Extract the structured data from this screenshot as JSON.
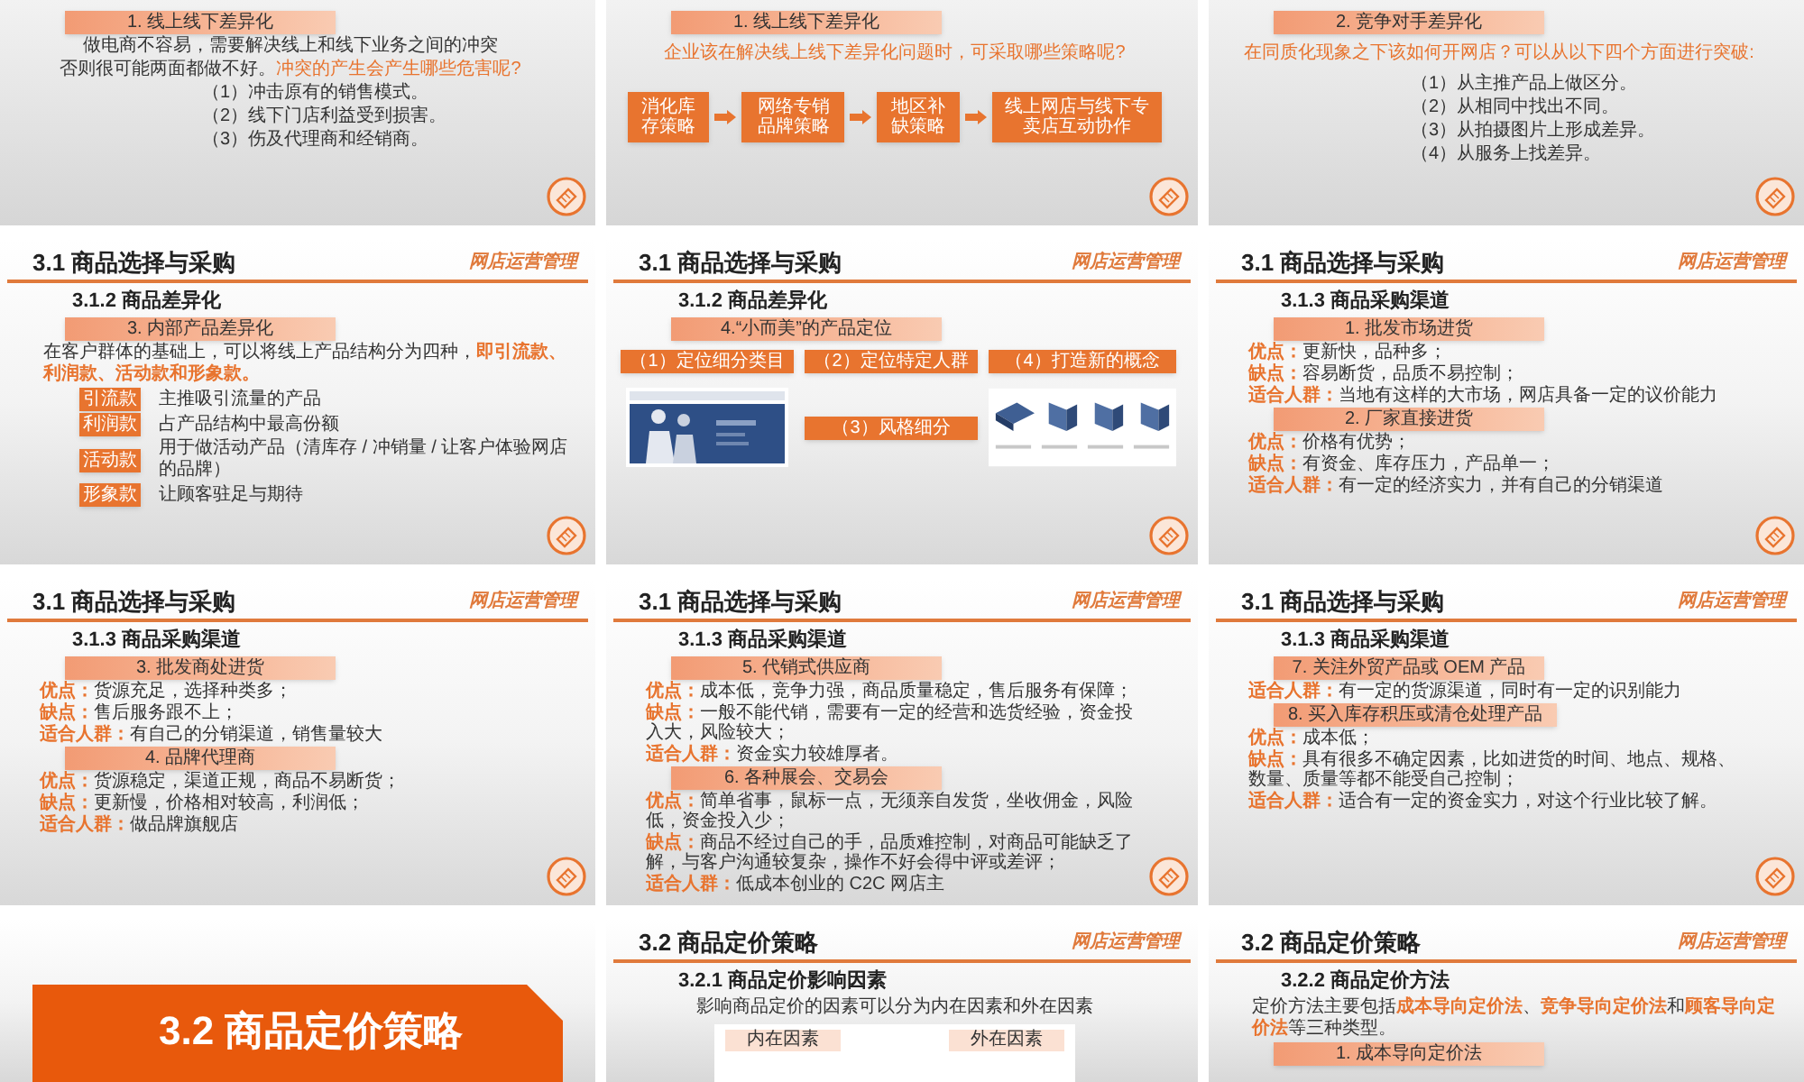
{
  "slides": [
    {
      "kind": "content",
      "blocks": [
        {
          "kind": "heading",
          "text": "1. 线上线下差异化"
        },
        {
          "kind": "lead",
          "text": "做电商不容易，需要解决线上和线下业务之间的冲突"
        },
        {
          "kind": "lead",
          "text": "否则很可能两面都做不好。**冲突的产生会产生哪些危害呢?**"
        },
        {
          "kind": "item",
          "text": "（1）冲击原有的销售模式。"
        },
        {
          "kind": "item",
          "text": "（2）线下门店利益受到损害。"
        },
        {
          "kind": "item",
          "text": "（3）伤及代理商和经销商。"
        }
      ]
    },
    {
      "kind": "content",
      "blocks": [
        {
          "kind": "heading",
          "text": "1. 线上线下差异化"
        },
        {
          "kind": "question",
          "text": "企业该在解决线上线下差异化问题时，可采取哪些策略呢?"
        },
        {
          "kind": "flow",
          "steps": [
            "消化库存策略",
            "网络专销品牌策略",
            "地区补缺策略",
            "线上网店与线下专卖店互动协作"
          ]
        }
      ]
    },
    {
      "kind": "content",
      "blocks": [
        {
          "kind": "heading",
          "text": "2. 竞争对手差异化"
        },
        {
          "kind": "question",
          "text": "在同质化现象之下该如何开网店？可以从以下四个方面进行突破:"
        },
        {
          "kind": "item",
          "text": "（1）从主推产品上做区分。"
        },
        {
          "kind": "item",
          "text": "（2）从相同中找出不同。"
        },
        {
          "kind": "item",
          "text": "（3）从拍摄图片上形成差异。"
        },
        {
          "kind": "item",
          "text": "（4）从服务上找差异。"
        }
      ]
    },
    {
      "kind": "content",
      "title": "3.1 商品选择与采购",
      "brand": "网店运营管理",
      "subtitle": "3.1.2 商品差异化",
      "blocks": [
        {
          "kind": "heading",
          "text": "3. 内部产品差异化"
        },
        {
          "kind": "paragraph",
          "text": "在客户群体的基础上，可以将线上产品结构分为四种，**即引流款、利润款、活动款和形象款。**"
        },
        {
          "kind": "tag_row",
          "tag": "引流款",
          "text": "主推吸引流量的产品"
        },
        {
          "kind": "tag_row",
          "tag": "利润款",
          "text": "占产品结构中最高份额"
        },
        {
          "kind": "tag_row",
          "tag": "活动款",
          "text": "用于做活动产品（清库存 / 冲销量 / 让客户体验网店的品牌）"
        },
        {
          "kind": "tag_row",
          "tag": "形象款",
          "text": "让顾客驻足与期待"
        }
      ]
    },
    {
      "kind": "content",
      "title": "3.1 商品选择与采购",
      "brand": "网店运营管理",
      "subtitle": "3.1.2 商品差异化",
      "blocks": [
        {
          "kind": "heading",
          "text": "4.“小而美”的产品定位"
        },
        {
          "kind": "grid",
          "items": [
            {
              "kind": "tag",
              "text": "（1）定位细分类目"
            },
            {
              "kind": "tag",
              "text": "（2）定位特定人群"
            },
            {
              "kind": "tag",
              "text": "（4）打造新的概念"
            },
            {
              "kind": "picture"
            },
            {
              "kind": "tag",
              "text": "（3）风格细分"
            },
            {
              "kind": "picture"
            }
          ]
        }
      ]
    },
    {
      "kind": "content",
      "title": "3.1 商品选择与采购",
      "brand": "网店运营管理",
      "subtitle": "3.1.3 商品采购渠道",
      "blocks": [
        {
          "kind": "heading",
          "text": "1. 批发市场进货"
        },
        {
          "kind": "pro",
          "label": "优点：",
          "text": "更新快，品种多；"
        },
        {
          "kind": "pro",
          "label": "缺点：",
          "text": "容易断货，品质不易控制；"
        },
        {
          "kind": "pro",
          "label": "适合人群：",
          "text": "当地有这样的大市场，网店具备一定的议价能力"
        },
        {
          "kind": "heading",
          "text": "2. 厂家直接进货"
        },
        {
          "kind": "pro",
          "label": "优点：",
          "text": "价格有优势；"
        },
        {
          "kind": "pro",
          "label": "缺点：",
          "text": "有资金、库存压力，产品单一；"
        },
        {
          "kind": "pro",
          "label": "适合人群：",
          "text": "有一定的经济实力，并有自己的分销渠道"
        }
      ]
    },
    {
      "kind": "content",
      "title": "3.1 商品选择与采购",
      "brand": "网店运营管理",
      "subtitle": "3.1.3 商品采购渠道",
      "blocks": [
        {
          "kind": "heading",
          "text": "3. 批发商处进货"
        },
        {
          "kind": "pro",
          "label": "优点：",
          "text": "货源充足，选择种类多；"
        },
        {
          "kind": "pro",
          "label": "缺点：",
          "text": "售后服务跟不上；"
        },
        {
          "kind": "pro",
          "label": "适合人群：",
          "text": "有自己的分销渠道，销售量较大"
        },
        {
          "kind": "heading",
          "text": "4. 品牌代理商"
        },
        {
          "kind": "pro",
          "label": "优点：",
          "text": "货源稳定，渠道正规，商品不易断货；"
        },
        {
          "kind": "pro",
          "label": "缺点：",
          "text": "更新慢，价格相对较高，利润低；"
        },
        {
          "kind": "pro",
          "label": "适合人群：",
          "text": "做品牌旗舰店"
        }
      ]
    },
    {
      "kind": "content",
      "title": "3.1 商品选择与采购",
      "brand": "网店运营管理",
      "subtitle": "3.1.3 商品采购渠道",
      "blocks": [
        {
          "kind": "heading",
          "text": "5. 代销式供应商"
        },
        {
          "kind": "pro",
          "label": "优点：",
          "text": "成本低，竞争力强，商品质量稳定，售后服务有保障；"
        },
        {
          "kind": "pro",
          "label": "缺点：",
          "text": "一般不能代销，需要有一定的经营和选货经验，资金投入大，风险较大；"
        },
        {
          "kind": "pro",
          "label": "适合人群：",
          "text": "资金实力较雄厚者。"
        },
        {
          "kind": "heading",
          "text": "6. 各种展会、交易会"
        },
        {
          "kind": "pro",
          "label": "优点：",
          "text": "简单省事，鼠标一点，无须亲自发货，坐收佣金，风险低，资金投入少；"
        },
        {
          "kind": "pro",
          "label": "缺点：",
          "text": "商品不经过自己的手，品质难控制，对商品可能缺乏了解，与客户沟通较复杂，操作不好会得中评或差评；"
        },
        {
          "kind": "pro",
          "label": "适合人群：",
          "text": "低成本创业的 C2C 网店主"
        }
      ]
    },
    {
      "kind": "content",
      "title": "3.1 商品选择与采购",
      "brand": "网店运营管理",
      "subtitle": "3.1.3 商品采购渠道",
      "blocks": [
        {
          "kind": "heading",
          "text": "7. 关注外贸产品或 OEM 产品"
        },
        {
          "kind": "pro",
          "label": "适合人群：",
          "text": "有一定的货源渠道，同时有一定的识别能力"
        },
        {
          "kind": "heading",
          "text": "8. 买入库存积压或清仓处理产品"
        },
        {
          "kind": "pro",
          "label": "优点：",
          "text": "成本低；"
        },
        {
          "kind": "pro",
          "label": "缺点：",
          "text": "具有很多不确定因素，比如进货的时间、地点、规格、数量、质量等都不能受自己控制；"
        },
        {
          "kind": "pro",
          "label": "适合人群：",
          "text": "适合有一定的资金实力，对这个行业比较了解。"
        }
      ]
    },
    {
      "kind": "section",
      "text": "3.2 商品定价策略"
    },
    {
      "kind": "content",
      "title": "3.2 商品定价策略",
      "brand": "网店运营管理",
      "subtitle": "3.2.1 商品定价影响因素",
      "blocks": [
        {
          "kind": "lead",
          "text": "影响商品定价的因素可以分为内在因素和外在因素"
        },
        {
          "kind": "factors",
          "items": [
            "内在因素",
            "外在因素"
          ]
        }
      ]
    },
    {
      "kind": "content",
      "title": "3.2 商品定价策略",
      "brand": "网店运营管理",
      "subtitle": "3.2.2 商品定价方法",
      "blocks": [
        {
          "kind": "paragraph",
          "text": "定价方法主要包括**成本导向定价法**、**竞争导向定价法**和**顾客导向定价法**等三种类型。"
        },
        {
          "kind": "heading",
          "text": "1. 成本导向定价法"
        }
      ]
    }
  ]
}
